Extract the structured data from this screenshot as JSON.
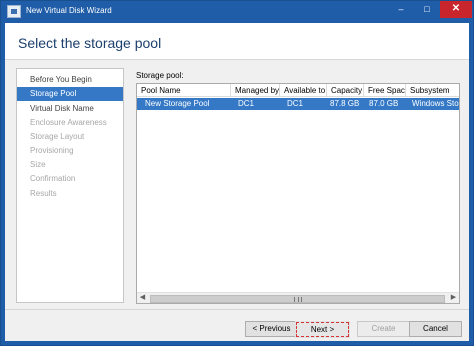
{
  "window": {
    "title": "New Virtual Disk Wizard",
    "controls": {
      "minimize": "–",
      "maximize": "□",
      "close": "✕"
    }
  },
  "header": {
    "title": "Select the storage pool"
  },
  "nav": {
    "items": [
      {
        "label": "Before You Begin",
        "state": "enabled"
      },
      {
        "label": "Storage Pool",
        "state": "selected"
      },
      {
        "label": "Virtual Disk Name",
        "state": "enabled"
      },
      {
        "label": "Enclosure Awareness",
        "state": "disabled"
      },
      {
        "label": "Storage Layout",
        "state": "disabled"
      },
      {
        "label": "Provisioning",
        "state": "disabled"
      },
      {
        "label": "Size",
        "state": "disabled"
      },
      {
        "label": "Confirmation",
        "state": "disabled"
      },
      {
        "label": "Results",
        "state": "disabled"
      }
    ]
  },
  "pool": {
    "label": "Storage pool:",
    "columns": [
      "Pool Name",
      "Managed by",
      "Available to",
      "Capacity",
      "Free Space",
      "Subsystem"
    ],
    "rows": [
      {
        "cells": [
          "New Storage Pool",
          "DC1",
          "DC1",
          "87.8 GB",
          "87.0 GB",
          "Windows Stora"
        ],
        "selected": true
      }
    ]
  },
  "scrollbar": {
    "left_arrow": "◀",
    "right_arrow": "▶"
  },
  "buttons": {
    "previous": "< Previous",
    "next": "Next >",
    "create": "Create",
    "cancel": "Cancel"
  },
  "colors": {
    "titlebar": "#1f5da8",
    "selection": "#3478c6",
    "close_button": "#c9252c",
    "page_title": "#1c3f6e"
  }
}
